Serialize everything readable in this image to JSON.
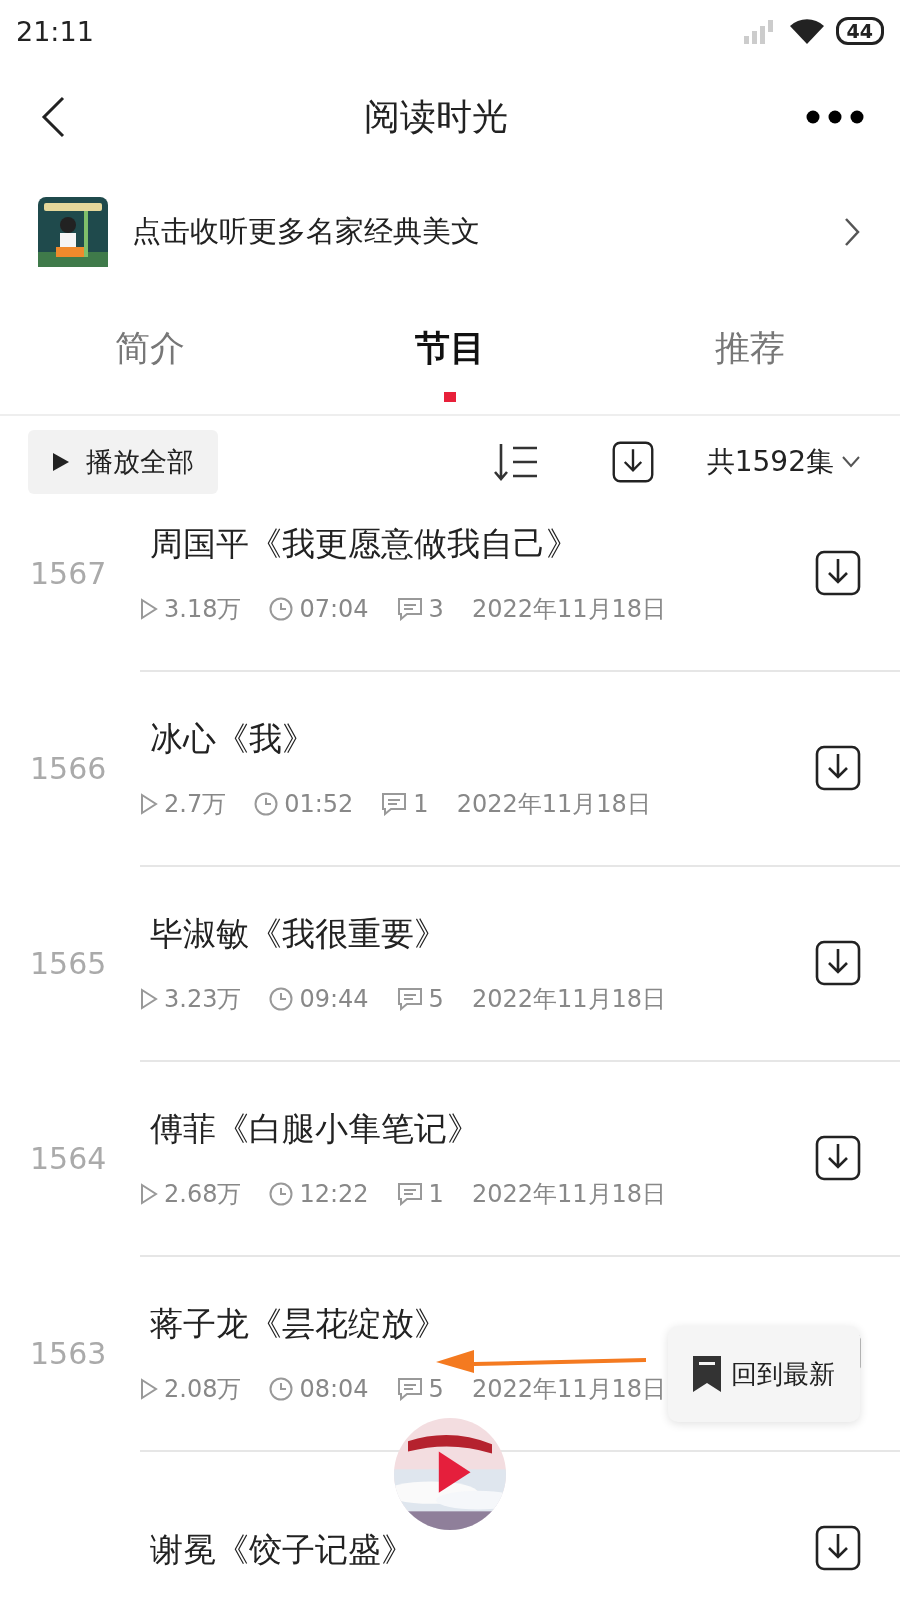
{
  "status_bar": {
    "time": "21:11",
    "battery": "44"
  },
  "nav": {
    "title": "阅读时光"
  },
  "banner": {
    "text": "点击收听更多名家经典美文"
  },
  "tabs": [
    {
      "label": "简介",
      "selected": false
    },
    {
      "label": "节目",
      "selected": true
    },
    {
      "label": "推荐",
      "selected": false
    }
  ],
  "toolbar": {
    "play_all": "播放全部",
    "count": "共1592集"
  },
  "episodes": [
    {
      "number": "1567",
      "title": "周国平《我更愿意做我自己》",
      "plays": "3.18万",
      "duration": "07:04",
      "comments": "3",
      "date": "2022年11月18日"
    },
    {
      "number": "1566",
      "title": "冰心《我》",
      "plays": "2.7万",
      "duration": "01:52",
      "comments": "1",
      "date": "2022年11月18日"
    },
    {
      "number": "1565",
      "title": "毕淑敏《我很重要》",
      "plays": "3.23万",
      "duration": "09:44",
      "comments": "5",
      "date": "2022年11月18日"
    },
    {
      "number": "1564",
      "title": "傅菲《白腿小隼笔记》",
      "plays": "2.68万",
      "duration": "12:22",
      "comments": "1",
      "date": "2022年11月18日"
    },
    {
      "number": "1563",
      "title": "蒋子龙《昙花绽放》",
      "plays": "2.08万",
      "duration": "08:04",
      "comments": "5",
      "date": "2022年11月18日"
    },
    {
      "title": "谢冕《饺子记盛》"
    }
  ],
  "back_to_latest": {
    "label": "回到最新"
  }
}
